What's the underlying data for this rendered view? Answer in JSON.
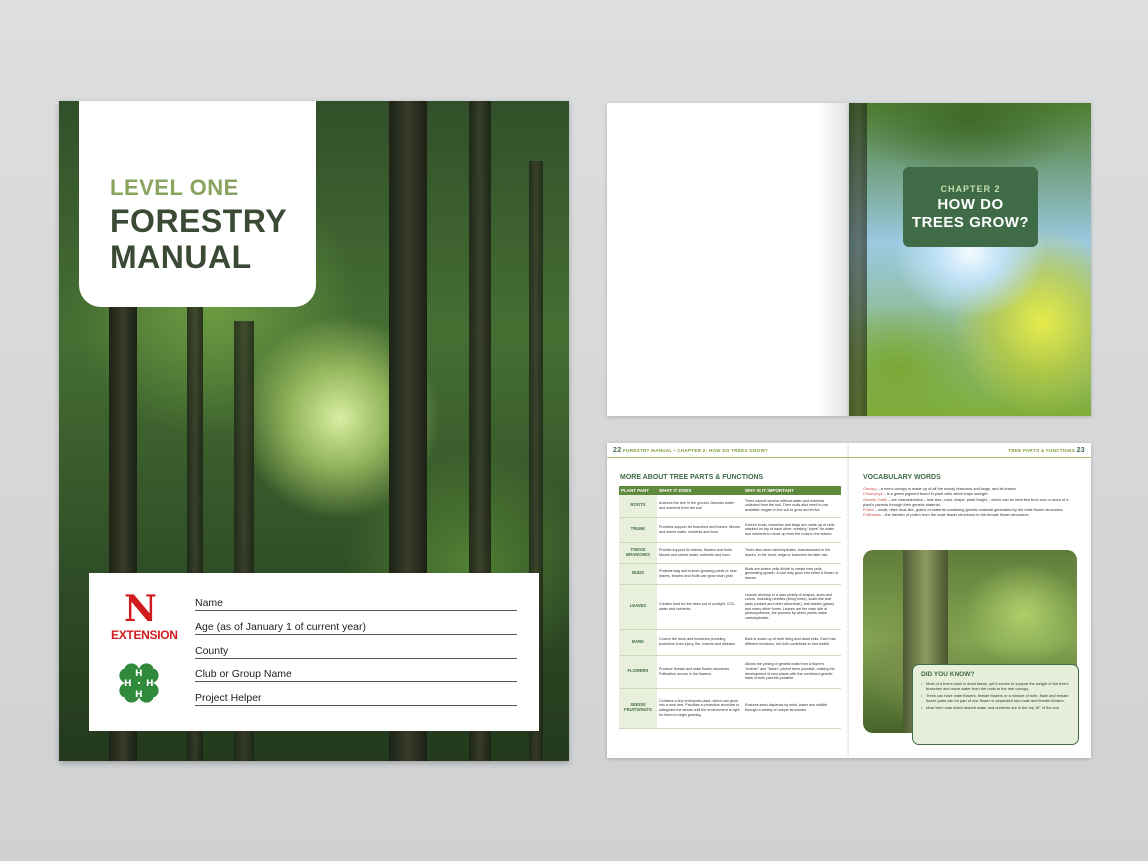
{
  "cover": {
    "level": "LEVEL ONE",
    "title_line1": "FORESTRY",
    "title_line2": "MANUAL",
    "extension_letter": "N",
    "extension_word": "EXTENSION",
    "fields": [
      "Name",
      "Age (as of January 1 of current year)",
      "County",
      "Club or Group Name",
      "Project Helper"
    ],
    "colors": {
      "accent_green": "#8aa35e",
      "title_dark": "#3a4a35",
      "extension_red": "#d01c1f",
      "clover_green": "#2f8a3c"
    }
  },
  "chapter_spread": {
    "chapter_label": "CHAPTER 2",
    "chapter_title_line1": "HOW DO",
    "chapter_title_line2": "TREES GROW?",
    "card_color": "#3f6b47"
  },
  "page22": {
    "page_number": "22",
    "running_head": "FORESTRY MANUAL  •  CHAPTER 2: HOW DO TREES GROW?",
    "section_title": "MORE ABOUT TREE PARTS & FUNCTIONS",
    "table": {
      "headers": [
        "PLANT PART",
        "WHAT IT DOES",
        "WHY IS IT IMPORTANT"
      ],
      "rows": [
        [
          "ROOTS",
          "Anchors the tree in the ground. Absorbs water and nutrients from the soil.",
          "Trees cannot survive without water and nutrients collected from the soil. Their roots also need to use available oxygen in the soil to grow and thrive."
        ],
        [
          "TRUNK",
          "Provides support for branches and leaves. Moves and stores water, nutrients and food.",
          "A tree's trunk, branches and twigs are made up of cells stacked on top of each other, creating \"pipes\" for water and nutrients to move up from the roots to the leaves."
        ],
        [
          "TWIGS/ BRANCHES",
          "Provide support for leaves, flowers and fruits. Moves and stores water, nutrients and food.",
          "Trees also store carbohydrates, manufactured in the leaves, in the trunk, twigs or branches for later use."
        ],
        [
          "BUDS",
          "Protects twig and branch growing points or new leaves, flowers and fruits can grow each year.",
          "Buds are where cells divide to create new cells, generating growth. A bud may grow into either a flower or leaves."
        ],
        [
          "LEAVES",
          "Creates food for the trees out of sunlight, CO2, water and nutrients.",
          "Leaves develop in a vast variety of shapes, sizes and colors, including needles (living trees), scale-like leaf pads (cedars and other arborvitae), leaf blades (grass) and many other forms. Leaves are the main site of photosynthesis, the process by which plants make carbohydrates."
        ],
        [
          "BARK",
          "Covers the trunk and branches providing protection from injury, fire, insects and disease.",
          "Bark is made up of both living and dead cells. Each has different functions, but both contribute to tree health."
        ],
        [
          "FLOWERS",
          "Produce female and male flower structures. Pollination occurs in the flowers.",
          "Allows the joining of genetic traits from a flower's \"mother\" and \"father\" parent trees possible, making the development of new plants with the combined genetic traits of both parents possible."
        ],
        [
          "SEEDS/ FRUITS/NUTS",
          "Contains a tiny embryonic plant, which can grow into a new tree. Provides a protective structure to safeguard the seeds until the environment is right for them to begin growing.",
          "Ensures seed dispersal by wind, water and wildlife through a variety of unique structures."
        ]
      ]
    }
  },
  "page23": {
    "page_number": "23",
    "running_head": "TREE PARTS & FUNCTIONS",
    "section_title": "VOCABULARY WORDS",
    "vocab": [
      {
        "term": "Canopy",
        "def": " – a tree's canopy is made up of all the woody branches and twigs, and its leaves."
      },
      {
        "term": "Chlorophyll",
        "def": " – is a green pigment found in plant cells which traps sunlight."
      },
      {
        "term": "Genetic Traits",
        "def": " – are characteristics – leaf size, color, shape, plant height – which can be inherited from one or more of a plant's parents through their genetic material."
      },
      {
        "term": "Pollen",
        "def": " – small, often dust-like, grains of material containing genetic material generated by the male flower structures."
      },
      {
        "term": "Pollination",
        "def": " – the transfer of pollen from the male flower structures to the female flower structures."
      }
    ],
    "did_you_know": {
      "title": "DID YOU KNOW?",
      "items": [
        "Most of a tree's trunk is dead tissue, yet it serves to support the weight of the tree's branches and move water from the roots to the tree canopy.",
        "Trees can have male flowers, female flowers or a mixture of both. Male and female flower parts can be part of one flower or separated into male and female flowers.",
        "Most tree roots which absorb water and nutrients are in the top 18\" of the soil."
      ]
    }
  }
}
